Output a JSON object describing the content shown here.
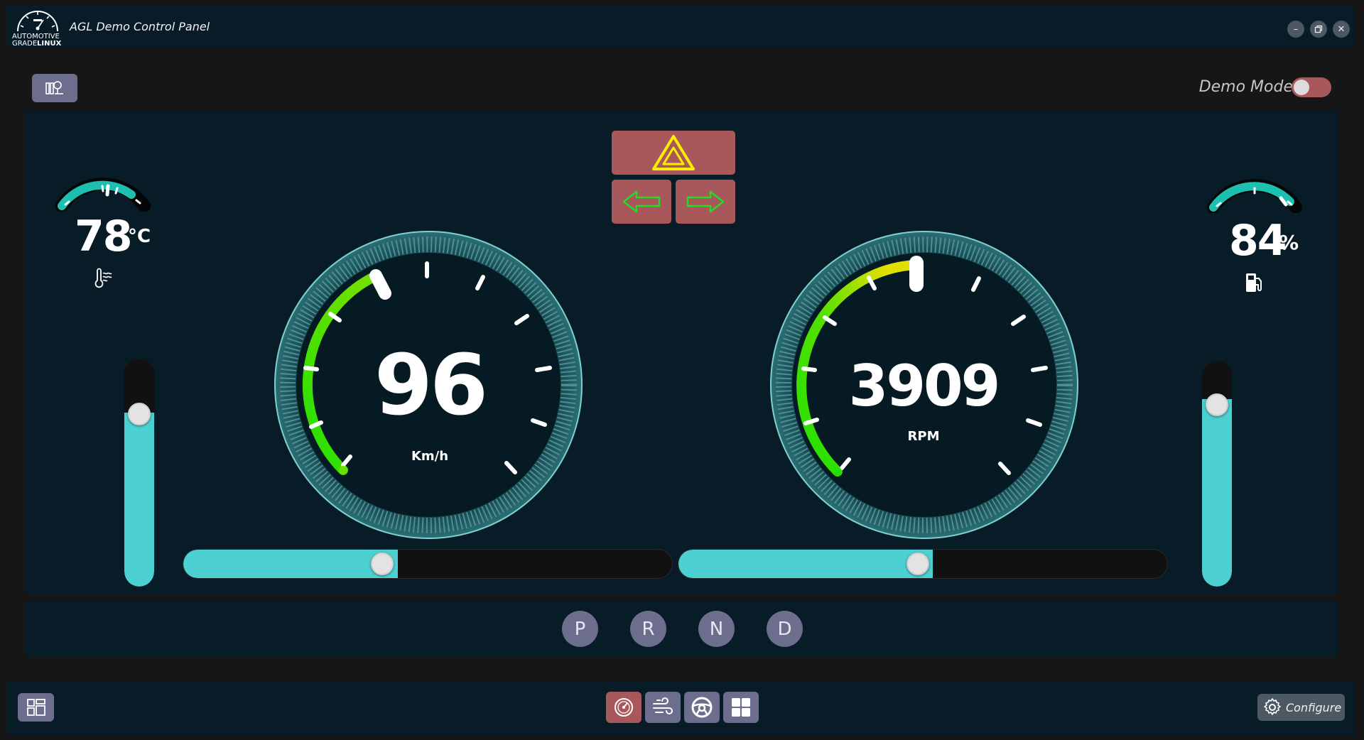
{
  "window": {
    "title": "AGL Demo Control Panel",
    "logo_text_line1": "AUTOMOTIVE",
    "logo_text_line2_a": "GRADE",
    "logo_text_line2_b": "LINUX",
    "minimize_icon": "minimize-icon",
    "restore_icon": "restore-icon",
    "close_icon": "close-icon"
  },
  "demo_mode": {
    "label": "Demo Mode",
    "enabled": false
  },
  "coolant": {
    "value": "78",
    "unit": "°C",
    "level": 0.72,
    "icon": "thermometer-icon"
  },
  "fuel": {
    "value": "84",
    "unit": "%",
    "level": 0.84,
    "icon": "fuel-pump-icon"
  },
  "speed": {
    "value": "96",
    "unit": "Km/h",
    "slider_level": 0.41
  },
  "rpm": {
    "value": "3909",
    "unit": "RPM",
    "slider_level": 0.49
  },
  "indicators": {
    "hazard_icon": "hazard-triangle-icon",
    "left_icon": "arrow-left-icon",
    "right_icon": "arrow-right-icon"
  },
  "gears": [
    "P",
    "R",
    "N",
    "D"
  ],
  "bottom_nav": [
    {
      "name": "dashboard",
      "icon": "speedometer-icon",
      "active": true
    },
    {
      "name": "hvac",
      "icon": "fan-wind-icon",
      "active": false
    },
    {
      "name": "steering",
      "icon": "steering-wheel-icon",
      "active": false
    },
    {
      "name": "apps",
      "icon": "grid-icon",
      "active": false
    }
  ],
  "configure": {
    "label": "Configure",
    "icon": "gear-icon"
  },
  "colors": {
    "accent": "#4dd0d2",
    "active": "#a8585a",
    "button": "#6d6e8e",
    "panel": "#071c26",
    "gauge_green": "#22e000",
    "gauge_yellow": "#d8e000",
    "arrow_green": "#22dd22",
    "hazard_yellow": "#ffee00"
  }
}
